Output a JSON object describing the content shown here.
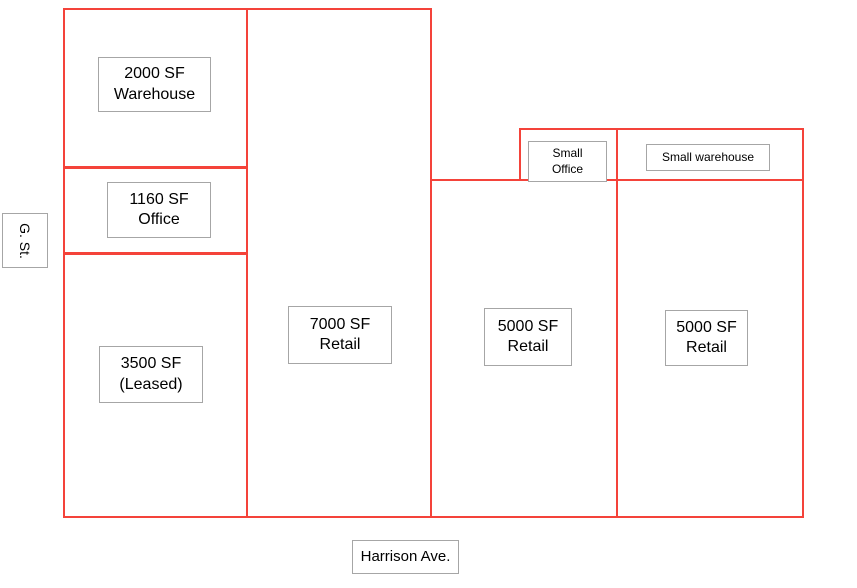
{
  "diagram": {
    "title": "Commercial property site / floor plan",
    "outline_color": "#f4433a",
    "label_border_color": "#a6a6a6",
    "background_color": "#ffffff"
  },
  "streets": [
    {
      "name": "street-g-st",
      "label": "G. St.",
      "orientation": "vertical-left"
    },
    {
      "name": "street-harrison-ave",
      "label": "Harrison Ave.",
      "orientation": "horizontal-bottom"
    }
  ],
  "units": [
    {
      "id": "unit-warehouse-2000",
      "line1": "2000 SF",
      "line2": "Warehouse",
      "area_sf": 2000,
      "use": "Warehouse",
      "status": "available"
    },
    {
      "id": "unit-office-1160",
      "line1": "1160 SF",
      "line2": "Office",
      "area_sf": 1160,
      "use": "Office",
      "status": "available"
    },
    {
      "id": "unit-leased-3500",
      "line1": "3500 SF",
      "line2": "(Leased)",
      "area_sf": 3500,
      "use": "",
      "status": "leased"
    },
    {
      "id": "unit-retail-7000",
      "line1": "7000 SF",
      "line2": "Retail",
      "area_sf": 7000,
      "use": "Retail",
      "status": "available"
    },
    {
      "id": "unit-retail-5000-center",
      "line1": "5000 SF",
      "line2": "Retail",
      "area_sf": 5000,
      "use": "Retail",
      "status": "available"
    },
    {
      "id": "unit-retail-5000-right",
      "line1": "5000 SF",
      "line2": "Retail",
      "area_sf": 5000,
      "use": "Retail",
      "status": "available"
    },
    {
      "id": "unit-small-office",
      "line1": "Small",
      "line2": "Office",
      "area_sf": null,
      "use": "Office",
      "status": "available"
    },
    {
      "id": "unit-small-warehouse",
      "line1": "Small warehouse",
      "line2": "",
      "area_sf": null,
      "use": "Warehouse",
      "status": "available"
    }
  ]
}
